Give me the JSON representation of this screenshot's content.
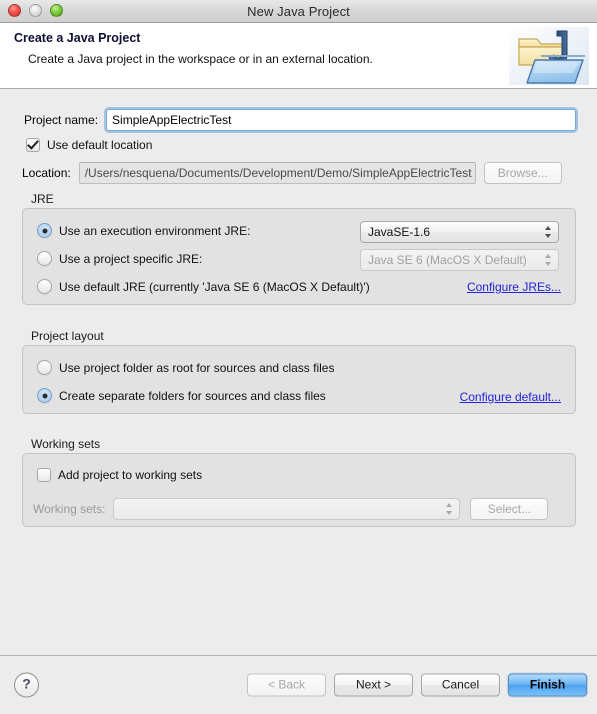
{
  "window": {
    "title": "New Java Project",
    "traffic_lights": [
      "close-button",
      "minimize-button",
      "maximize-button"
    ]
  },
  "header": {
    "title": "Create a Java Project",
    "description": "Create a Java project in the workspace or in an external location.",
    "icon": "java-project-folder-icon"
  },
  "project": {
    "name_label": "Project name:",
    "name_value": "SimpleAppElectricTest",
    "name_placeholder": "",
    "use_default_location_label": "Use default location",
    "use_default_location_checked": true,
    "location_label": "Location:",
    "location_value": "/Users/nesquena/Documents/Development/Demo/SimpleAppElectricTest",
    "browse_label": "Browse..."
  },
  "jre": {
    "group_label": "JRE",
    "options": [
      {
        "label": "Use an execution environment JRE:",
        "selected": true,
        "combo_value": "JavaSE-1.6",
        "combo_disabled": false
      },
      {
        "label": "Use a project specific JRE:",
        "selected": false,
        "combo_value": "Java SE 6 (MacOS X Default)",
        "combo_disabled": true
      },
      {
        "label": "Use default JRE (currently 'Java SE 6 (MacOS X Default)')",
        "selected": false
      }
    ],
    "configure_link": "Configure JREs..."
  },
  "project_layout": {
    "group_label": "Project layout",
    "options": [
      {
        "label": "Use project folder as root for sources and class files",
        "selected": false
      },
      {
        "label": "Create separate folders for sources and class files",
        "selected": true
      }
    ],
    "configure_link": "Configure default..."
  },
  "working_sets": {
    "group_label": "Working sets",
    "add_checkbox_label": "Add project to working sets",
    "add_checkbox_checked": false,
    "sets_label": "Working sets:",
    "sets_value": "",
    "select_label": "Select..."
  },
  "footer": {
    "help_glyph": "?",
    "back_label": "< Back",
    "back_disabled": true,
    "next_label": "Next >",
    "cancel_label": "Cancel",
    "finish_label": "Finish"
  },
  "colors": {
    "window_bg": "#ececec",
    "group_bg": "#e2e2e2",
    "link": "#2323d8",
    "default_button": "#4ea2ef",
    "focus_ring": "#6ea0dc",
    "title_text": "#2b2b2b"
  }
}
